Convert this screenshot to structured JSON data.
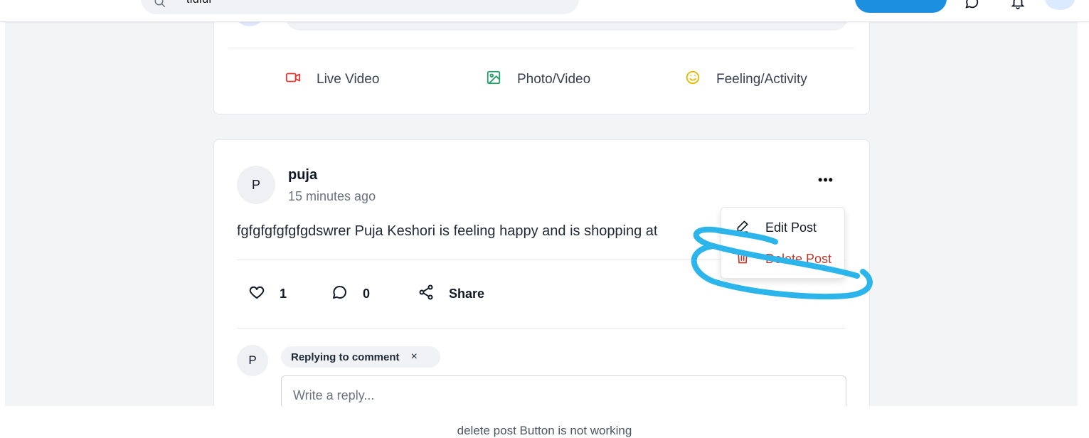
{
  "header": {
    "search_value": "tfdfdf",
    "icons": [
      "search-icon",
      "chat-icon",
      "bell-icon"
    ]
  },
  "composer": {
    "actions": [
      {
        "label": "Live Video",
        "icon": "video-icon",
        "color": "#e53935"
      },
      {
        "label": "Photo/Video",
        "icon": "image-icon",
        "color": "#22a06b"
      },
      {
        "label": "Feeling/Activity",
        "icon": "smile-icon",
        "color": "#e6b800"
      }
    ]
  },
  "post": {
    "avatar_initial": "P",
    "author": "puja",
    "time": "15 minutes ago",
    "more_label": "•••",
    "text": "fgfgfgfgfgfgdswrer Puja Keshori is feeling happy and is shopping at",
    "likes": "1",
    "comments": "0",
    "share_label": "Share"
  },
  "menu": {
    "edit_label": "Edit Post",
    "delete_label": "Delete Post"
  },
  "reply": {
    "avatar_initial": "P",
    "chip_label": "Replying to comment",
    "chip_close": "×",
    "placeholder": "Write a reply..."
  },
  "annotation": {
    "color": "#2cb5ea"
  },
  "caption": "delete post Button is not working"
}
